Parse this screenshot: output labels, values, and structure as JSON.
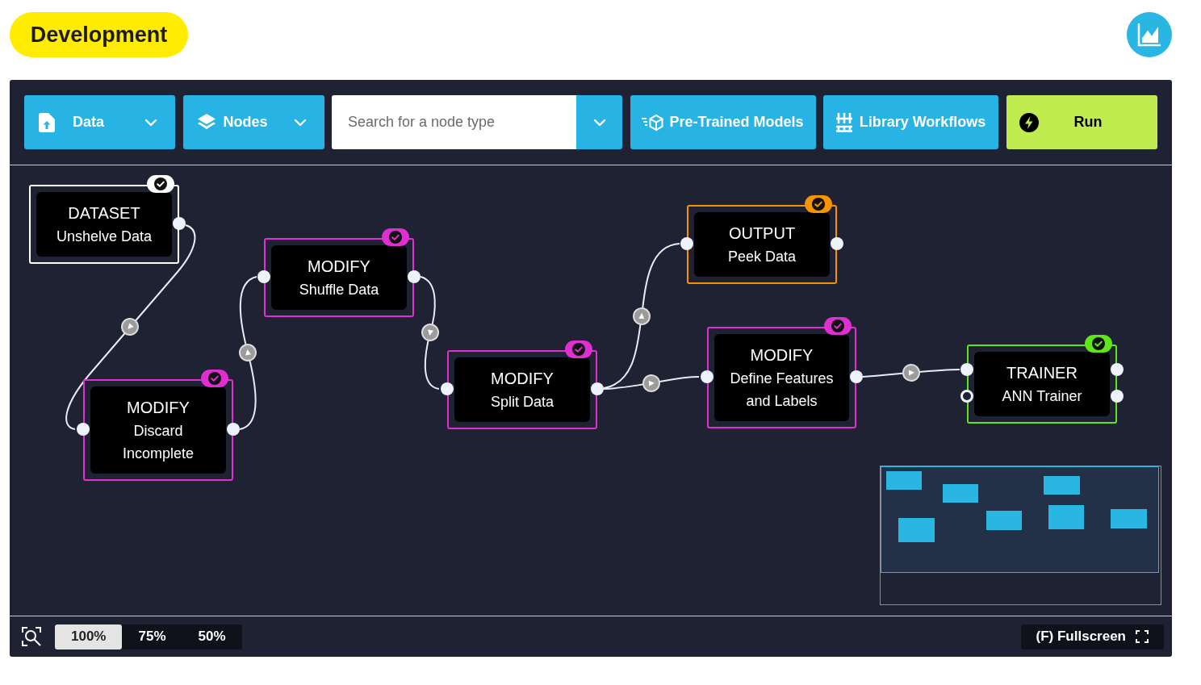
{
  "header": {
    "badge": "Development"
  },
  "toolbar": {
    "menus": [
      {
        "label": "Data"
      },
      {
        "label": "Nodes"
      }
    ],
    "search": {
      "placeholder": "Search for a node type"
    },
    "actions": [
      {
        "label": "Pre-Trained Models"
      },
      {
        "label": "Library Workflows"
      }
    ],
    "run": {
      "label": "Run"
    }
  },
  "canvas": {
    "nodes": [
      {
        "category": "DATASET",
        "title": "Unshelve Data",
        "color": "#ffffff",
        "completed": true
      },
      {
        "category": "MODIFY",
        "title": "Discard Incomplete",
        "color": "#e02fd0",
        "completed": true
      },
      {
        "category": "MODIFY",
        "title": "Shuffle Data",
        "color": "#e02fd0",
        "completed": true
      },
      {
        "category": "MODIFY",
        "title": "Split Data",
        "color": "#e02fd0",
        "completed": true
      },
      {
        "category": "OUTPUT",
        "title": "Peek Data",
        "color": "#f59300",
        "completed": true
      },
      {
        "category": "MODIFY",
        "title": "Define Features and Labels",
        "color": "#e02fd0",
        "completed": true
      },
      {
        "category": "TRAINER",
        "title": "ANN Trainer",
        "color": "#5ee61a",
        "completed": true
      }
    ]
  },
  "footer": {
    "zoom_levels": [
      {
        "label": "100%",
        "selected": true
      },
      {
        "label": "75%",
        "selected": false
      },
      {
        "label": "50%",
        "selected": false
      }
    ],
    "fullscreen": {
      "label": "(F) Fullscreen"
    }
  }
}
